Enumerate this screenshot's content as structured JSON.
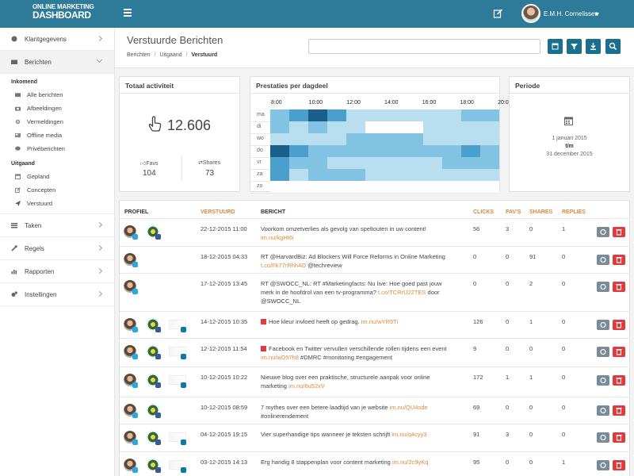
{
  "header": {
    "logo_line1": "ONLINE MARKETING",
    "logo_line2": "DASHBOARD",
    "username": "E.M.H. Cornelissen"
  },
  "sidebar": {
    "items_top": [
      {
        "label": "Klantgegevens",
        "icon": "globe-icon"
      },
      {
        "label": "Berichten",
        "icon": "envelope-icon"
      }
    ],
    "inkomend_head": "Inkomend",
    "inkomend": [
      {
        "label": "Alle berichten",
        "icon": "envelope-icon"
      },
      {
        "label": "Afbeeldingen",
        "icon": "camera-icon"
      },
      {
        "label": "Vermeldingen",
        "icon": "cog-icon"
      },
      {
        "label": "Offline media",
        "icon": "newspaper-icon"
      },
      {
        "label": "Privéberichten",
        "icon": "chat-icon"
      }
    ],
    "uitgaand_head": "Uitgaand",
    "uitgaand": [
      {
        "label": "Gepland",
        "icon": "calendar-icon"
      },
      {
        "label": "Concepten",
        "icon": "edit-icon"
      },
      {
        "label": "Verstuurd",
        "icon": "send-icon"
      }
    ],
    "items_bottom": [
      {
        "label": "Taken",
        "icon": "tasks-icon"
      },
      {
        "label": "Regels",
        "icon": "wrench-icon"
      },
      {
        "label": "Rapporten",
        "icon": "bar-chart-icon"
      },
      {
        "label": "Instellingen",
        "icon": "cogs-icon"
      }
    ]
  },
  "page": {
    "title": "Verstuurde Berichten",
    "crumb1": "Berichten",
    "crumb2": "Uitgaand",
    "crumb3": "Verstuurd",
    "search_placeholder": ""
  },
  "totaal": {
    "title": "Totaal activiteit",
    "value": "12.606",
    "favs_label": "Favs",
    "favs_value": "104",
    "shares_label": "Shares",
    "shares_value": "73"
  },
  "prestaties": {
    "title": "Prestaties per dagdeel",
    "hours": [
      "8:00",
      "10:00",
      "12:00",
      "14:00",
      "16:00",
      "18:00",
      "20:00"
    ],
    "days": [
      "ma",
      "di",
      "wo",
      "do",
      "vr",
      "za",
      "zo"
    ],
    "intensity": [
      [
        2,
        3,
        4,
        3,
        1,
        1,
        1,
        1,
        1,
        1,
        2,
        2
      ],
      [
        2,
        1,
        2,
        1,
        1,
        0,
        0,
        0,
        1,
        1,
        1,
        1
      ],
      [
        1,
        1,
        1,
        1,
        2,
        2,
        2,
        2,
        1,
        1,
        1,
        1
      ],
      [
        4,
        3,
        2,
        2,
        2,
        2,
        2,
        2,
        2,
        2,
        3,
        2
      ],
      [
        3,
        2,
        2,
        1,
        1,
        1,
        1,
        1,
        1,
        2,
        2,
        2
      ],
      [
        3,
        1,
        2,
        2,
        2,
        1,
        1,
        1,
        1,
        1,
        1,
        1
      ],
      [
        0,
        0,
        0,
        0,
        0,
        0,
        0,
        0,
        0,
        0,
        0,
        0
      ]
    ],
    "colors": [
      "#ffffff",
      "#b8def0",
      "#82c3e3",
      "#4b9fcc",
      "#1a5f8a"
    ]
  },
  "periode": {
    "title": "Periode",
    "from": "1 januari 2015",
    "sep": "t/m",
    "to": "31 december 2015"
  },
  "table": {
    "headers": {
      "profiel": "PROFIEL",
      "verstuurd": "VERSTUURD",
      "bericht": "BERICHT",
      "clicks": "CLICKS",
      "favs": "FAV'S",
      "shares": "SHARES",
      "replies": "REPLIES"
    },
    "rows": [
      {
        "profiles": [
          "tw",
          "fb"
        ],
        "date": "22-12-2015 11:00",
        "text": "Voorkom omzetverlies als gevolg van speltouten in uw content!",
        "link": "im.nu/kgHt6i",
        "line2": "",
        "gift": false,
        "clicks": "56",
        "favs": "3",
        "shares": "0",
        "replies": "1"
      },
      {
        "profiles": [
          "tw"
        ],
        "date": "18-12-2015 04:33",
        "text": "RT @HarvardBiz: Ad Blockers Will Force Reforms in Online Marketing",
        "link": "t.co/Fk77rRhh4O",
        "after": " @techreview",
        "gift": false,
        "clicks": "0",
        "favs": "0",
        "shares": "91",
        "replies": "0"
      },
      {
        "profiles": [
          "tw"
        ],
        "date": "17-12-2015 13:45",
        "text": "RT @SWOCC_NL: RT #Marketingfacts: Nu live: Hoe goed past jouw",
        "text2": "merk in de hoofdrol van een tv-programma?",
        "link": "t.co/TCRrU22TES",
        "after": " door",
        "text3": "@SWOCC_NL",
        "gift": false,
        "clicks": "0",
        "favs": "0",
        "shares": "2",
        "replies": "0"
      },
      {
        "profiles": [
          "tw",
          "fb",
          "li"
        ],
        "date": "14-12-2015 10:35",
        "text": "Hoe kleur invloed heeft op gedrag.",
        "link": "im.nu/wYR5Ti",
        "gift": true,
        "clicks": "126",
        "favs": "0",
        "shares": "1",
        "replies": "0"
      },
      {
        "profiles": [
          "tw",
          "fb",
          "li"
        ],
        "date": "12-12-2015 11:54",
        "text": "Facebook en Twitter vervullen verschillende rollen tijdens een event",
        "link": "im.nu/wD57h8",
        "after": " #DMRC #monitoring #engagement",
        "gift": true,
        "clicks": "9",
        "favs": "0",
        "shares": "0",
        "replies": "0"
      },
      {
        "profiles": [
          "tw",
          "fb",
          "li"
        ],
        "date": "10-12-2015 10:22",
        "text": "Nieuwe blog over een praktische, structurele aanpak voor online",
        "text2": "marketing",
        "link": "im.nu/6u52xV",
        "gift": false,
        "clicks": "172",
        "favs": "1",
        "shares": "1",
        "replies": "0"
      },
      {
        "profiles": [
          "tw",
          "fb"
        ],
        "date": "10-12-2015 08:59",
        "text": "7 mythes over een betere laadtijd van je website",
        "link": "im.nu/QU4sde",
        "text2": "#onlinerendement",
        "gift": false,
        "clicks": "69",
        "favs": "0",
        "shares": "0",
        "replies": "0"
      },
      {
        "profiles": [
          "tw",
          "fb",
          "li"
        ],
        "date": "04-12-2015 19:15",
        "text": "Vier superhandige tips wanneer je teksten schrijft",
        "link": "im.nu/q4cyy3",
        "gift": false,
        "clicks": "91",
        "favs": "3",
        "shares": "0",
        "replies": "0"
      },
      {
        "profiles": [
          "tw",
          "fb",
          "li"
        ],
        "date": "03-12-2015 14:13",
        "text": "Erg handig 8 stappenplan voor content marketing",
        "link": "im.nu/2c9yKq",
        "gift": false,
        "clicks": "95",
        "favs": "0",
        "shares": "0",
        "replies": "1"
      }
    ]
  }
}
